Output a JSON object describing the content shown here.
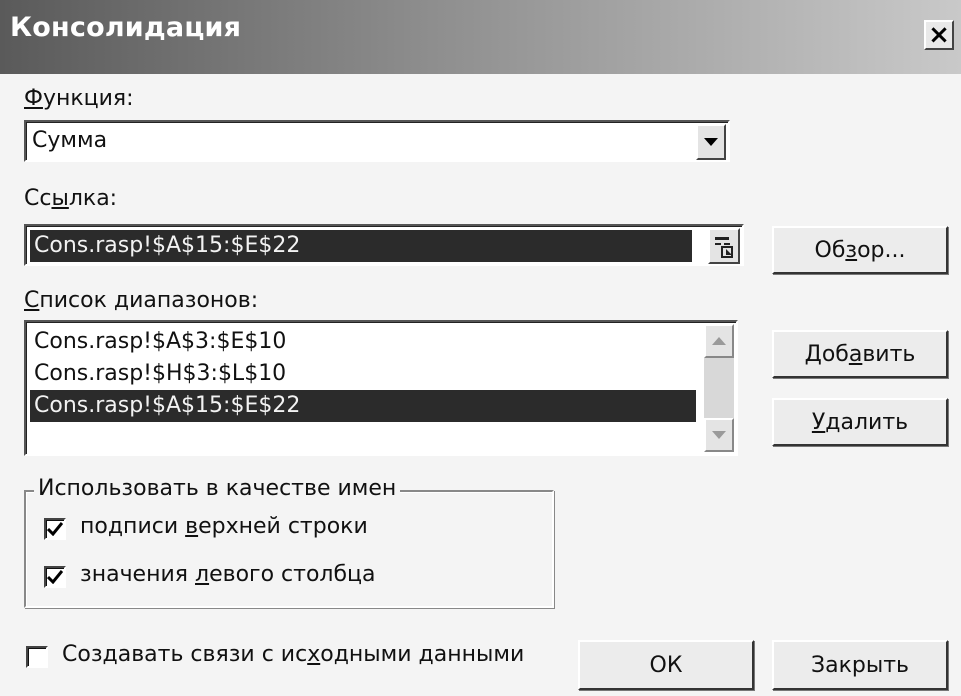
{
  "window": {
    "title": "Консолидация",
    "close_label": "×"
  },
  "function": {
    "label_prefix": "",
    "label_accel": "Ф",
    "label_rest": "ункция:",
    "value": "Сумма"
  },
  "reference": {
    "label_prefix": "Сс",
    "label_accel": "ы",
    "label_rest": "лка:",
    "value": "Cons.rasp!$A$15:$E$22"
  },
  "ranges": {
    "label_prefix": "",
    "label_accel": "С",
    "label_rest": "писок диапазонов:",
    "items": [
      "Cons.rasp!$A$3:$E$10",
      "Cons.rasp!$H$3:$L$10",
      "Cons.rasp!$A$15:$E$22"
    ],
    "selected_index": 2
  },
  "use_labels": {
    "group_title": "Использовать в качестве имен",
    "top_row": {
      "prefix": "подписи ",
      "accel": "в",
      "rest": "ерхней строки",
      "checked": true
    },
    "left_column": {
      "prefix": "значения ",
      "accel": "л",
      "rest": "евого столбца",
      "checked": true
    }
  },
  "links": {
    "prefix": "Создавать связи с ис",
    "accel": "х",
    "rest": "одными данными",
    "checked": false
  },
  "buttons": {
    "browse": {
      "prefix": "Об",
      "accel": "з",
      "rest": "ор..."
    },
    "add": {
      "prefix": "Доб",
      "accel": "а",
      "rest": "вить"
    },
    "delete": {
      "prefix": "",
      "accel": "У",
      "rest": "далить"
    },
    "ok": "ОК",
    "close": "Закрыть"
  }
}
